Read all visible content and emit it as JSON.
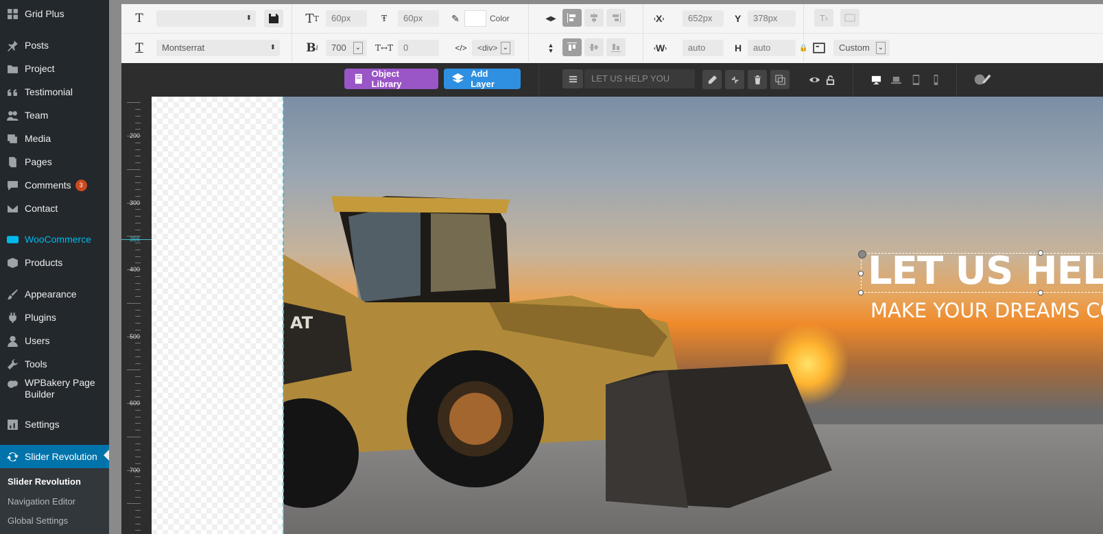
{
  "sidebar": {
    "items": [
      {
        "label": "Grid Plus",
        "icon": "grid-icon"
      },
      {
        "label": "Posts",
        "icon": "pin-icon"
      },
      {
        "label": "Project",
        "icon": "folder-icon"
      },
      {
        "label": "Testimonial",
        "icon": "quote-icon"
      },
      {
        "label": "Team",
        "icon": "group-icon"
      },
      {
        "label": "Media",
        "icon": "media-icon"
      },
      {
        "label": "Pages",
        "icon": "pages-icon"
      },
      {
        "label": "Comments",
        "icon": "comment-icon",
        "badge": "3"
      },
      {
        "label": "Contact",
        "icon": "mail-icon"
      },
      {
        "label": "WooCommerce",
        "icon": "woo-icon"
      },
      {
        "label": "Products",
        "icon": "box-icon"
      },
      {
        "label": "Appearance",
        "icon": "brush-icon"
      },
      {
        "label": "Plugins",
        "icon": "plug-icon"
      },
      {
        "label": "Users",
        "icon": "user-icon"
      },
      {
        "label": "Tools",
        "icon": "wrench-icon"
      },
      {
        "label": "WPBakery Page Builder",
        "icon": "wpbakery-icon"
      },
      {
        "label": "Settings",
        "icon": "settings-icon"
      },
      {
        "label": "Slider Revolution",
        "icon": "refresh-icon"
      }
    ],
    "submenu": [
      "Slider Revolution",
      "Navigation Editor",
      "Global Settings"
    ]
  },
  "toolbar": {
    "font_size": "60px",
    "line_height": "60px",
    "color_label": "Color",
    "x_label": "X",
    "x_value": "652px",
    "y_label": "Y",
    "y_value": "378px",
    "font_family": "Montserrat",
    "font_weight": "700",
    "letter_spacing": "0",
    "tag": "<div>",
    "w_label": "W",
    "w_value": "auto",
    "h_label": "H",
    "h_value": "auto",
    "size_mode": "Custom"
  },
  "layerbar": {
    "object_library": "Object Library",
    "add_layer": "Add Layer",
    "layer_name": "LET US HELP YOU"
  },
  "ruler": {
    "labels": [
      "200",
      "300",
      "355",
      "400",
      "500",
      "600",
      "700"
    ],
    "marker": "355"
  },
  "slide": {
    "headline": "LET US HELP YOU",
    "subline": "MAKE YOUR DREAMS COME TRUE",
    "brand_text": "AT"
  },
  "colors": {
    "sidebar_bg": "#23282d",
    "active_blue": "#0073aa",
    "object_library_btn": "#9a55c6",
    "add_layer_btn": "#2f8fe0",
    "guide_cyan": "#3fc0d0"
  }
}
